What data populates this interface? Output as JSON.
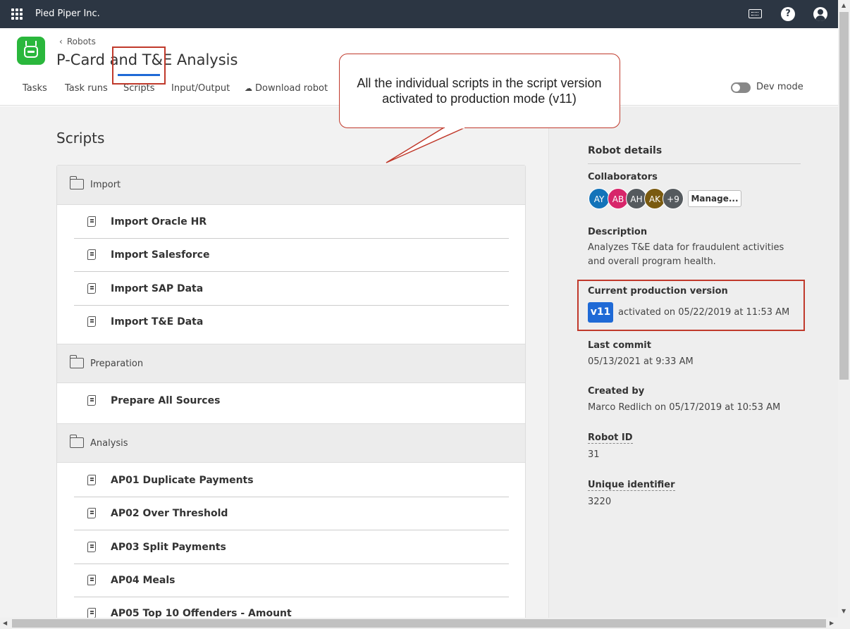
{
  "topbar": {
    "org_name": "Pied Piper Inc."
  },
  "header": {
    "breadcrumb": "Robots",
    "title": "P-Card and T&E Analysis",
    "tabs": [
      "Tasks",
      "Task runs",
      "Scripts",
      "Input/Output",
      "Download robot"
    ],
    "dev_mode_label": "Dev mode"
  },
  "main": {
    "title": "Scripts",
    "groups": [
      {
        "name": "Import",
        "items": [
          "Import Oracle HR",
          "Import Salesforce",
          "Import SAP Data",
          "Import T&E Data"
        ]
      },
      {
        "name": "Preparation",
        "items": [
          "Prepare All Sources"
        ]
      },
      {
        "name": "Analysis",
        "items": [
          "AP01 Duplicate Payments",
          "AP02 Over Threshold",
          "AP03 Split Payments",
          "AP04 Meals",
          "AP05 Top 10 Offenders - Amount"
        ]
      }
    ]
  },
  "details": {
    "title": "Robot details",
    "collaborators_label": "Collaborators",
    "avatars": [
      {
        "initials": "AY",
        "color": "#1373b9"
      },
      {
        "initials": "AB",
        "color": "#d7266a"
      },
      {
        "initials": "AH",
        "color": "#555a5e"
      },
      {
        "initials": "AK",
        "color": "#7a5a10"
      },
      {
        "initials": "+9",
        "color": "#555a5e"
      }
    ],
    "manage_label": "Manage...",
    "description_label": "Description",
    "description": "Analyzes T&E data for fraudulent activities and overall program health.",
    "prod_label": "Current production version",
    "prod_version": "v11",
    "prod_activated": "activated on 05/22/2019 at 11:53 AM",
    "commit_label": "Last commit",
    "commit_value": "05/13/2021 at 9:33 AM",
    "created_label": "Created by",
    "created_value": "Marco Redlich on 05/17/2019 at 10:53 AM",
    "robot_id_label": "Robot ID",
    "robot_id": "31",
    "uid_label": "Unique identifier",
    "uid": "3220"
  },
  "callout": {
    "line1": "All the individual scripts in the script version",
    "line2": "activated to production mode (v11)"
  },
  "colors": {
    "accent": "#1f6ad6",
    "annotation": "#c0392b",
    "topbar": "#2c3643",
    "robot_logo": "#2ab73c"
  }
}
